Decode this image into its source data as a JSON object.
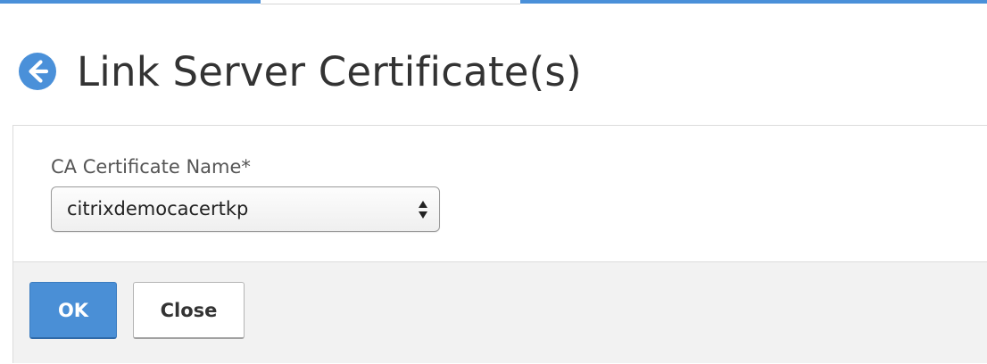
{
  "header": {
    "title": "Link Server Certificate(s)",
    "back_icon": "arrow-left-circle-icon"
  },
  "form": {
    "ca_certificate": {
      "label": "CA Certificate Name*",
      "selected_value": "citrixdemocacertkp",
      "dropdown_icon": "updown-arrows-icon"
    }
  },
  "footer": {
    "ok_label": "OK",
    "close_label": "Close"
  },
  "colors": {
    "accent": "#4a8fd6",
    "title_text": "#333333",
    "footer_bg": "#f2f2f2"
  }
}
